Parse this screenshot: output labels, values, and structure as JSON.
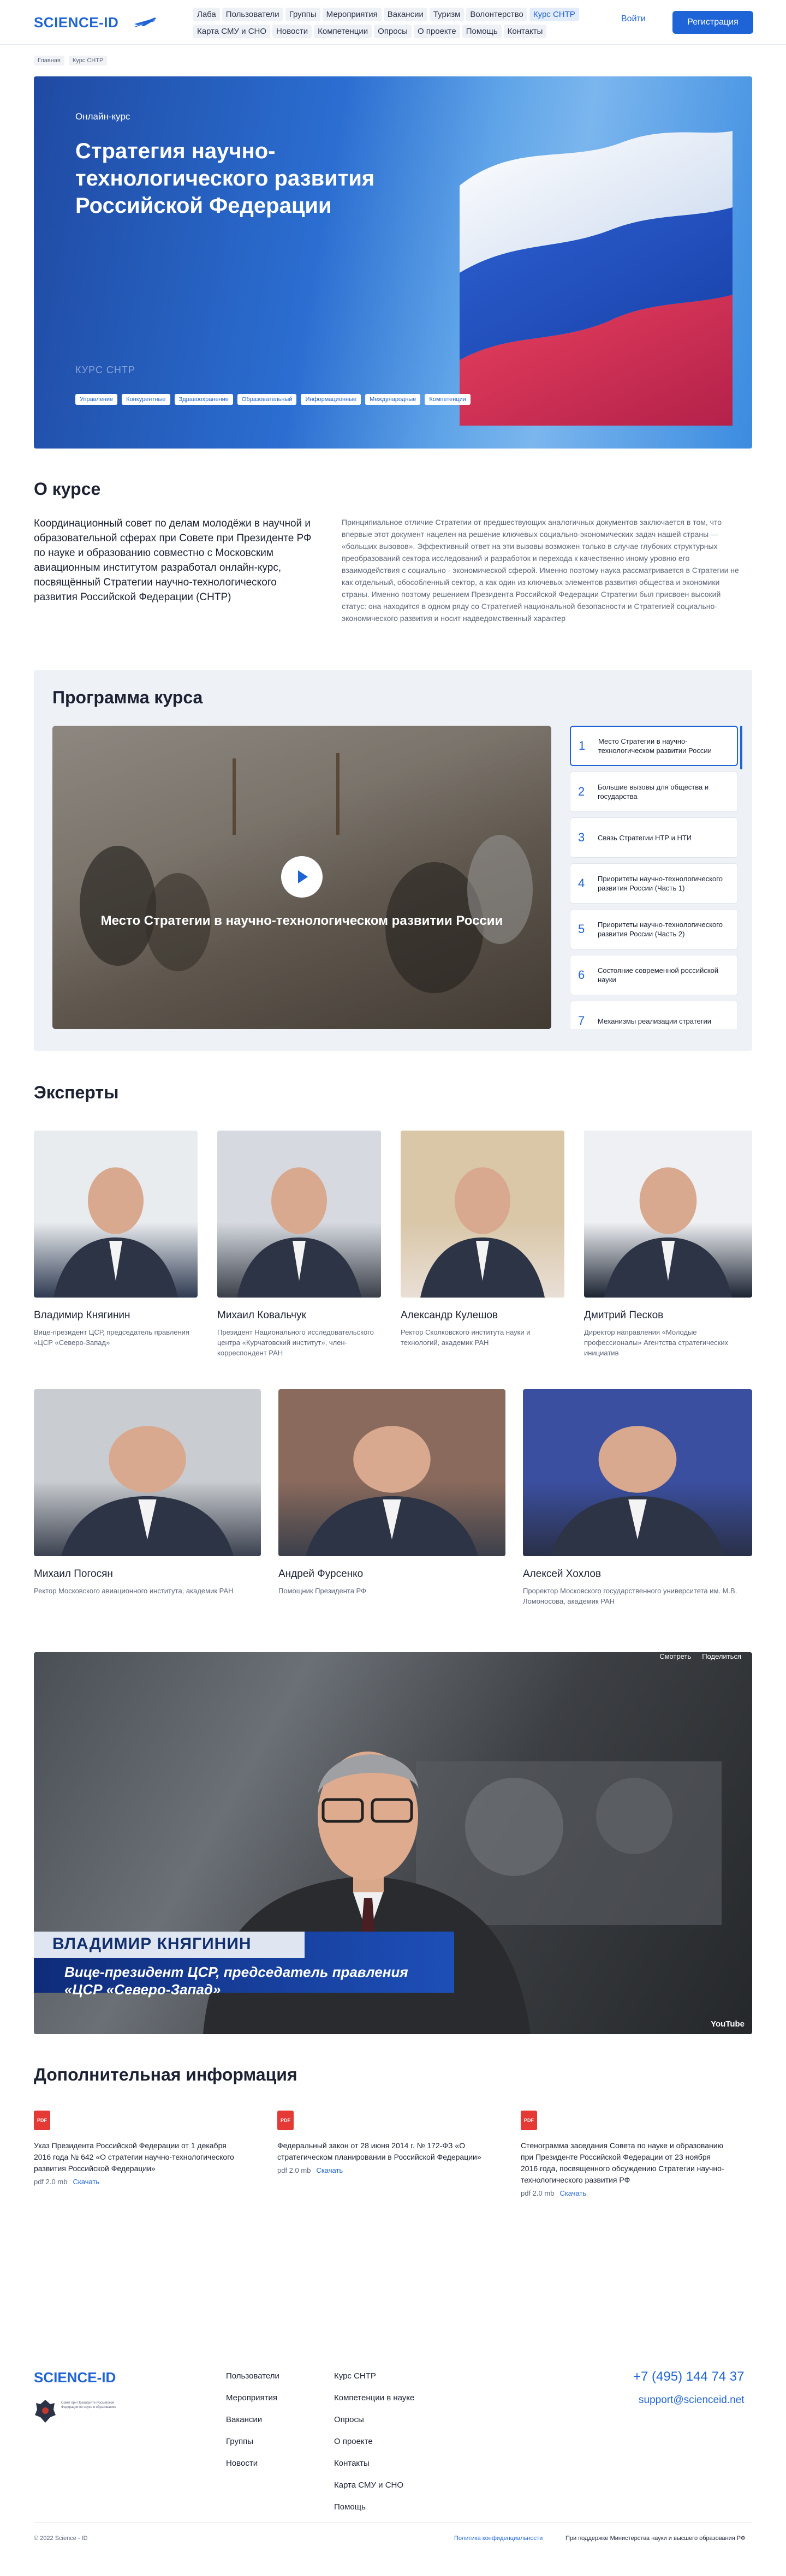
{
  "header": {
    "logo": "SCIENCE-ID",
    "nav": [
      "Лаба",
      "Пользователи",
      "Группы",
      "Мероприятия",
      "Вакансии",
      "Туризм",
      "Волонтерство",
      "Курс СНТР",
      "Карта СМУ и СНО",
      "Новости",
      "Компетенции",
      "Опросы",
      "О проекте",
      "Помощь",
      "Контакты"
    ],
    "nav_active": "Курс СНТР",
    "login": "Войти",
    "register": "Регистрация"
  },
  "breadcrumbs": [
    "Главная",
    "Курс СНТР"
  ],
  "hero": {
    "pretitle": "Онлайн-курс",
    "title": "Стратегия научно-технологического развития Российской Федерации",
    "subtitle": "КУРС СНТР",
    "tags": [
      "Управление",
      "Конкурентные",
      "Здравоохранение",
      "Образовательный",
      "Информационные",
      "Международные",
      "Компетенции"
    ]
  },
  "about": {
    "heading": "О курсе",
    "lead": "Координационный совет по делам молодёжи в научной и образовательной сферах при Совете при Президенте РФ по науке и образованию совместно с Московским авиационным институтом разработал онлайн-курс, посвящённый Стратегии научно-технологического развития Российской Федерации (СНТР)",
    "body": "Принципиальное отличие Стратегии от предшествующих аналогичных документов заключается в том, что впервые этот документ нацелен на решение ключевых социально-экономических задач нашей страны — «больших вызовов». Эффективный ответ на эти вызовы возможен только в случае глубоких структурных преобразований сектора исследований и разработок и перехода к качественно иному уровню его взаимодействия с социально - экономической сферой. Именно поэтому наука рассматривается в Стратегии не как отдельный, обособленный сектор, а как один из ключевых элементов развития общества и экономики страны. Именно поэтому решением Президента Российской Федерации Стратегии был присвоен высокий статус: она находится в одном ряду со Стратегией национальной безопасности и Стратегией социально-экономического развития и носит надведомственный характер"
  },
  "program": {
    "heading": "Программа курса",
    "video_caption": "Место Стратегии в научно-технологическом развитии России",
    "lessons": [
      {
        "num": "1",
        "title": "Место Стратегии в научно-технологическом развитии России"
      },
      {
        "num": "2",
        "title": "Большие вызовы для общества и государства"
      },
      {
        "num": "3",
        "title": "Связь Стратегии НТР и НТИ"
      },
      {
        "num": "4",
        "title": "Приоритеты научно-технологического развития России (Часть 1)"
      },
      {
        "num": "5",
        "title": "Приоритеты научно-технологического развития России (Часть 2)"
      },
      {
        "num": "6",
        "title": "Состояние современной российской науки"
      },
      {
        "num": "7",
        "title": "Механизмы реализации стратегии"
      }
    ]
  },
  "experts": {
    "heading": "Эксперты",
    "items": [
      {
        "name": "Владимир Княгинин",
        "desc": "Вице-президент ЦСР, председатель правления «ЦСР «Северо-Запад»"
      },
      {
        "name": "Михаил Ковальчук",
        "desc": "Президент Национального исследовательского центра «Курчатовский институт», член-корреспондент РАН"
      },
      {
        "name": "Александр Кулешов",
        "desc": "Ректор Сколковского института науки и технологий, академик РАН"
      },
      {
        "name": "Дмитрий Песков",
        "desc": "Директор направления «Молодые профессионалы» Агентства стратегических инициатив"
      },
      {
        "name": "Михаил Погосян",
        "desc": "Ректор Московского авиационного института, академик РАН"
      },
      {
        "name": "Андрей Фурсенко",
        "desc": "Помощник Президента РФ"
      },
      {
        "name": "Алексей Хохлов",
        "desc": "Проректор Московского государственного университета им. М.В. Ломоносова, академик РАН"
      }
    ]
  },
  "interview": {
    "tabs": [
      "Смотреть",
      "Поделиться"
    ],
    "name": "ВЛАДИМИР КНЯГИНИН",
    "role": "Вице-президент ЦСР, председатель правления «ЦСР «Северо-Запад»",
    "platform": "YouTube"
  },
  "info": {
    "heading": "Дополнительная информация",
    "docs": [
      {
        "icon": "PDF",
        "title": "Указ Президента Российской Федерации от 1 декабря 2016 года № 642 «О стратегии научно-технологического развития Российской Федерации»",
        "meta": "pdf 2.0 mb",
        "link": "Скачать"
      },
      {
        "icon": "PDF",
        "title": "Федеральный закон от 28 июня 2014 г. № 172-ФЗ «О стратегическом планировании в Российской Федерации»",
        "meta": "pdf 2.0 mb",
        "link": "Скачать"
      },
      {
        "icon": "PDF",
        "title": "Стенограмма заседания Совета по науке и образованию при Президенте Российской Федерации от 23 ноября 2016 года, посвященного обсуждению Стратегии научно-технологического развития РФ",
        "meta": "pdf 2.0 mb",
        "link": "Скачать"
      }
    ]
  },
  "footer": {
    "logo": "SCIENCE-ID",
    "emblem_text": "Совет при Президенте Российской Федерации по науке и образованию",
    "col1": [
      "Пользователи",
      "Мероприятия",
      "Вакансии",
      "Группы",
      "Новости"
    ],
    "col2": [
      "Курс СНТР",
      "Компетенции в науке",
      "Опросы",
      "О проекте",
      "Контакты",
      "Карта СМУ и СНО",
      "Помощь"
    ],
    "phone": "+7 (495) 144 74 37",
    "email": "support@scienceid.net",
    "copyright": "© 2022 Science - ID",
    "privacy": "Политика конфиденциальности",
    "support": "При поддержке Министерства науки и высшего образования РФ"
  },
  "colors": {
    "accent": "#1e64d6",
    "text": "#1c2233",
    "muted": "#5d6578",
    "panel": "#eef1f6",
    "pdf": "#e53935"
  }
}
